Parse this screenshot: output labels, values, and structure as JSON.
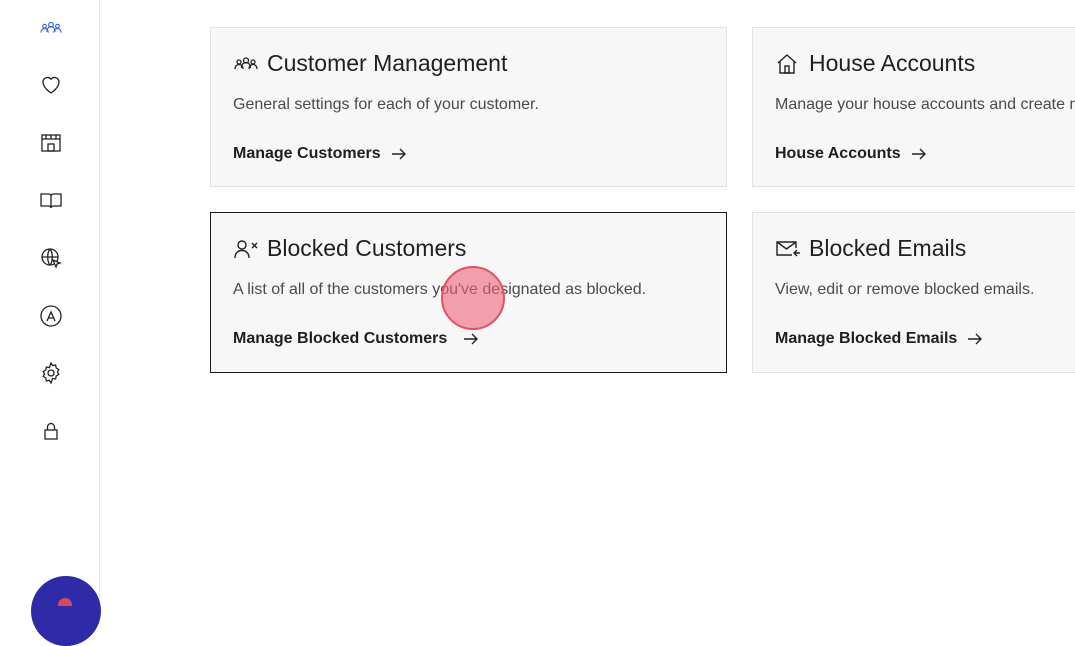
{
  "sidebar": {
    "items": [
      {
        "icon": "customers-icon"
      },
      {
        "icon": "heart-icon"
      },
      {
        "icon": "store-icon"
      },
      {
        "icon": "book-icon"
      },
      {
        "icon": "globe-cursor-icon"
      },
      {
        "icon": "app-store-icon"
      },
      {
        "icon": "gear-icon"
      },
      {
        "icon": "lock-icon"
      }
    ]
  },
  "cards": {
    "customer_management": {
      "title": "Customer Management",
      "description": "General settings for each of your customer.",
      "link": "Manage Customers"
    },
    "house_accounts": {
      "title": "House Accounts",
      "description": "Manage your house accounts and create ne",
      "link": "House Accounts"
    },
    "blocked_customers": {
      "title": "Blocked Customers",
      "description": "A list of all of the customers you've designated as blocked.",
      "link": "Manage Blocked Customers"
    },
    "blocked_emails": {
      "title": "Blocked Emails",
      "description": "View, edit or remove blocked emails.",
      "link": "Manage Blocked Emails"
    }
  },
  "colors": {
    "accent_sidebar": "#2f5fd0",
    "help_bubble": "#2e2aa8",
    "click_marker": "#f06478"
  }
}
